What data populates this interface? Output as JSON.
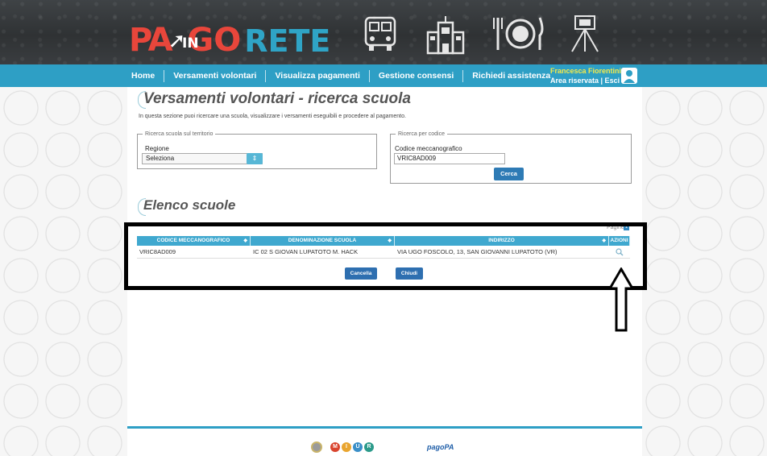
{
  "header": {
    "logo": {
      "part1": "PA",
      "part2": "GO",
      "in": "IN",
      "rete": "RETE"
    },
    "decor_icons": [
      "bus-icon",
      "school-icon",
      "plate-icon",
      "blackboard-icon"
    ]
  },
  "nav": {
    "items": [
      "Home",
      "Versamenti volontari",
      "Visualizza pagamenti",
      "Gestione consensi",
      "Richiedi assistenza"
    ],
    "user_name": "Francesca Fiorentini",
    "user_links": "Area riservata | Esci",
    "avatar_icon": "user-icon"
  },
  "page": {
    "title": "Versamenti volontari - ricerca scuola",
    "intro": "In questa sezione puoi ricercare una scuola, visualizzare i versamenti eseguibili e procedere al pagamento.",
    "territory": {
      "legend": "Ricerca scuola sul territorio",
      "label": "Regione",
      "value": "Seleziona"
    },
    "by_code": {
      "legend": "Ricerca per codice",
      "label": "Codice meccanografico",
      "value": "VRIC8AD009",
      "button": "Cerca"
    },
    "list_title": "Elenco scuole",
    "pages_label": "Pagine",
    "page_number": "1"
  },
  "table": {
    "columns": [
      "CODICE MECCANOGRAFICO",
      "DENOMINAZIONE SCUOLA",
      "INDIRIZZO",
      "AZIONI"
    ],
    "rows": [
      [
        "VRIC8AD009",
        "IC 02 S GIOVAN LUPATOTO M. HACK",
        "VIA UGO FOSCOLO, 13, SAN GIOVANNI LUPATOTO (VR)",
        "search-icon"
      ]
    ]
  },
  "buttons": {
    "cancel": "Cancella",
    "close": "Chiudi"
  },
  "footer": {
    "pagopa": "pagoPA",
    "miur_letters": [
      "M",
      "I",
      "U",
      "R"
    ]
  },
  "colors": {
    "nav": "#2e9fc5",
    "table_header": "#3fa8cf",
    "button": "#2e6fb0",
    "user_name": "#f4e94a",
    "logo_red": "#e8463b",
    "logo_blue": "#2fa4c6"
  }
}
